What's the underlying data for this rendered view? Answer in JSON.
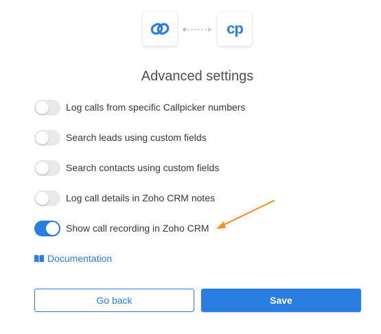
{
  "title": "Advanced settings",
  "logos": {
    "left_icon": "zoho-link-icon",
    "right_icon": "callpicker-cp-icon",
    "right_text": "cp",
    "connector_icon": "dashed-arrow-connector"
  },
  "settings": [
    {
      "label": "Log calls from specific Callpicker numbers",
      "enabled": false
    },
    {
      "label": "Search leads using custom fields",
      "enabled": false
    },
    {
      "label": "Search contacts using custom fields",
      "enabled": false
    },
    {
      "label": "Log call details in Zoho CRM notes",
      "enabled": false
    },
    {
      "label": "Show call recording in Zoho CRM",
      "enabled": true
    }
  ],
  "documentation": {
    "label": "Documentation",
    "icon": "book-icon"
  },
  "buttons": {
    "back_label": "Go back",
    "save_label": "Save"
  },
  "colors": {
    "accent": "#2a7de1",
    "annotation_arrow": "#f0932b",
    "toggle_off": "#e9e9ea"
  }
}
